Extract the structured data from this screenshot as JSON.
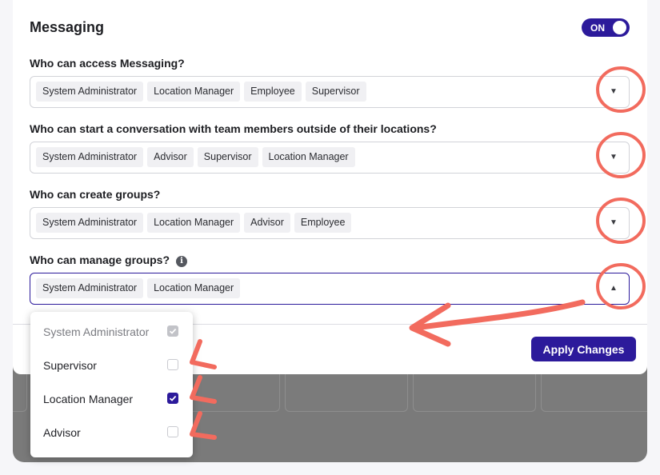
{
  "section": {
    "title": "Messaging",
    "toggle_label": "ON"
  },
  "questions": [
    {
      "label": "Who can access Messaging?",
      "chips": [
        "System Administrator",
        "Location Manager",
        "Employee",
        "Supervisor"
      ]
    },
    {
      "label": "Who can start a conversation with team members outside of their locations?",
      "chips": [
        "System Administrator",
        "Advisor",
        "Supervisor",
        "Location Manager"
      ]
    },
    {
      "label": "Who can create groups?",
      "chips": [
        "System Administrator",
        "Location Manager",
        "Advisor",
        "Employee"
      ]
    },
    {
      "label": "Who can manage groups?",
      "chips": [
        "System Administrator",
        "Location Manager"
      ]
    }
  ],
  "dropdown": {
    "options": [
      {
        "label": "System Administrator",
        "checked": true,
        "disabled": true
      },
      {
        "label": "Supervisor",
        "checked": false,
        "disabled": false
      },
      {
        "label": "Location Manager",
        "checked": true,
        "disabled": false
      },
      {
        "label": "Advisor",
        "checked": false,
        "disabled": false
      }
    ]
  },
  "footer": {
    "apply_label": "Apply Changes"
  },
  "icons": {
    "info": "info-icon",
    "caret_down": "caret-down-icon",
    "caret_up": "caret-up-icon",
    "checkmark": "checkmark-icon"
  },
  "colors": {
    "accent": "#2c1a9b",
    "annotation": "#f26b5e",
    "overlay": "#7a7a7a"
  }
}
